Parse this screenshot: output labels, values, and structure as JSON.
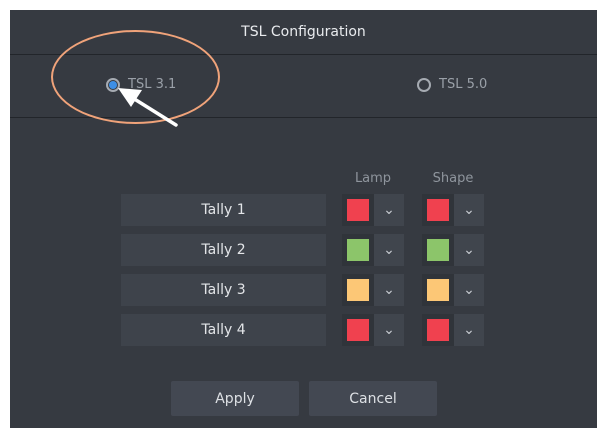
{
  "title": "TSL Configuration",
  "protocols": [
    {
      "label": "TSL 3.1",
      "selected": true
    },
    {
      "label": "TSL 5.0",
      "selected": false
    }
  ],
  "columns": {
    "lamp": "Lamp",
    "shape": "Shape"
  },
  "tallies": [
    {
      "name": "Tally 1",
      "lamp_color": "#f0414f",
      "shape_color": "#f0414f"
    },
    {
      "name": "Tally 2",
      "lamp_color": "#8cc56a",
      "shape_color": "#8cc56a"
    },
    {
      "name": "Tally 3",
      "lamp_color": "#fcc776",
      "shape_color": "#fcc776"
    },
    {
      "name": "Tally 4",
      "lamp_color": "#f0414f",
      "shape_color": "#f0414f"
    }
  ],
  "buttons": {
    "apply": "Apply",
    "cancel": "Cancel"
  },
  "annotation_color": "#f0a37a"
}
